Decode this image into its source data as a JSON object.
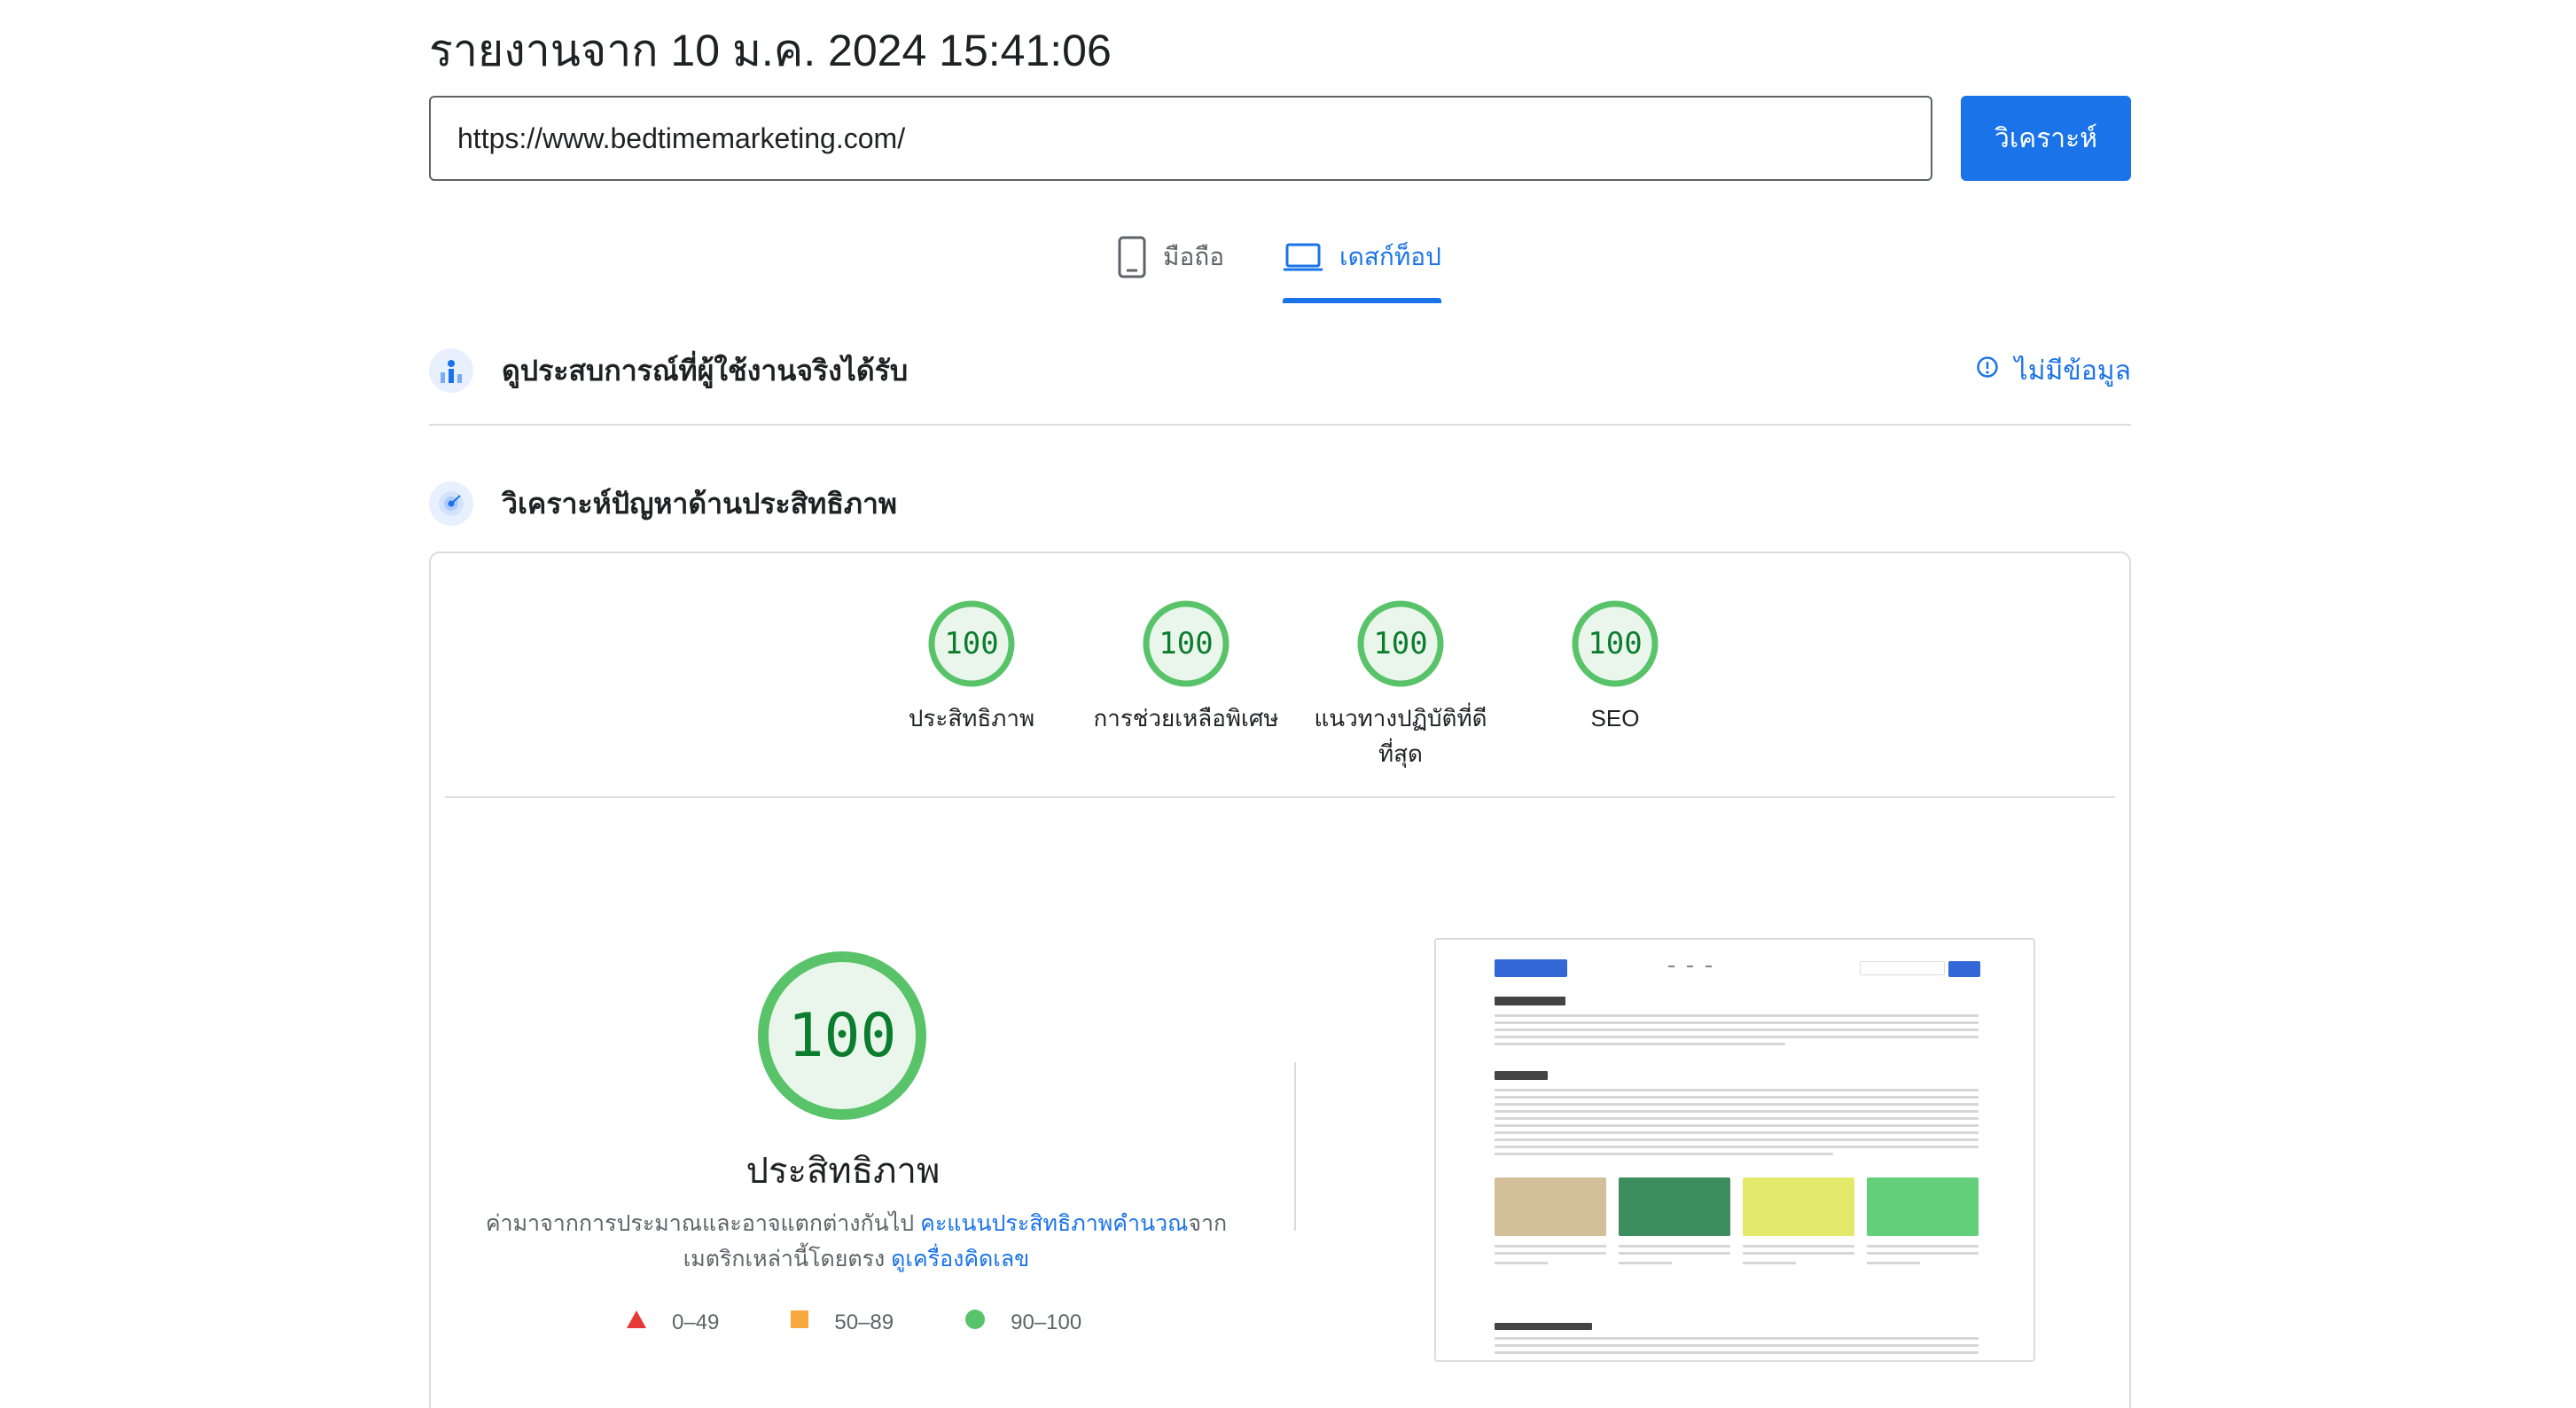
{
  "header": {
    "title": "รายงานจาก 10 ม.ค. 2024 15:41:06"
  },
  "url_bar": {
    "value": "https://www.bedtimemarketing.com/",
    "analyze_label": "วิเคราะห์"
  },
  "device_tabs": [
    {
      "label": "มือถือ",
      "icon": "mobile-phone-icon",
      "active": false
    },
    {
      "label": "เดสก์ท็อป",
      "icon": "laptop-icon",
      "active": true
    }
  ],
  "field_data": {
    "label": "ดูประสบการณ์ที่ผู้ใช้งานจริงได้รับ",
    "status": "ไม่มีข้อมูล",
    "icon": "users-chart-icon",
    "status_icon": "info-icon"
  },
  "lab_data": {
    "label": "วิเคราะห์ปัญหาด้านประสิทธิภาพ",
    "icon": "diagnostics-radar-icon"
  },
  "scores": [
    {
      "title": "ประสิทธิภาพ",
      "score": "100"
    },
    {
      "title": "การช่วยเหลือพิเศษ",
      "score": "100"
    },
    {
      "title": "แนวทางปฏิบัติที่ดีที่สุด",
      "score": "100"
    },
    {
      "title": "SEO",
      "score": "100"
    }
  ],
  "performance": {
    "score": "100",
    "title": "ประสิทธิภาพ",
    "desc_part1": "ค่ามาจากการประมาณและอาจแตกต่างกันไป ",
    "desc_link1": "คะแนนประสิทธิภาพคำนวณ",
    "desc_part2": "จากเมตริกเหล่านี้โดยตรง ",
    "desc_link2": "ดูเครื่องคิดเลข"
  },
  "legend": [
    {
      "range": "0–49",
      "shape": "triangle",
      "color": "#e53935"
    },
    {
      "range": "50–89",
      "shape": "square",
      "color": "#f9a93b"
    },
    {
      "range": "90–100",
      "shape": "circle",
      "color": "#59c36a"
    }
  ],
  "colors": {
    "accent": "#1a73e8",
    "pass": "#0c7d2e",
    "pass_ring": "#59c36a",
    "pass_bg": "#eaf6ec"
  }
}
